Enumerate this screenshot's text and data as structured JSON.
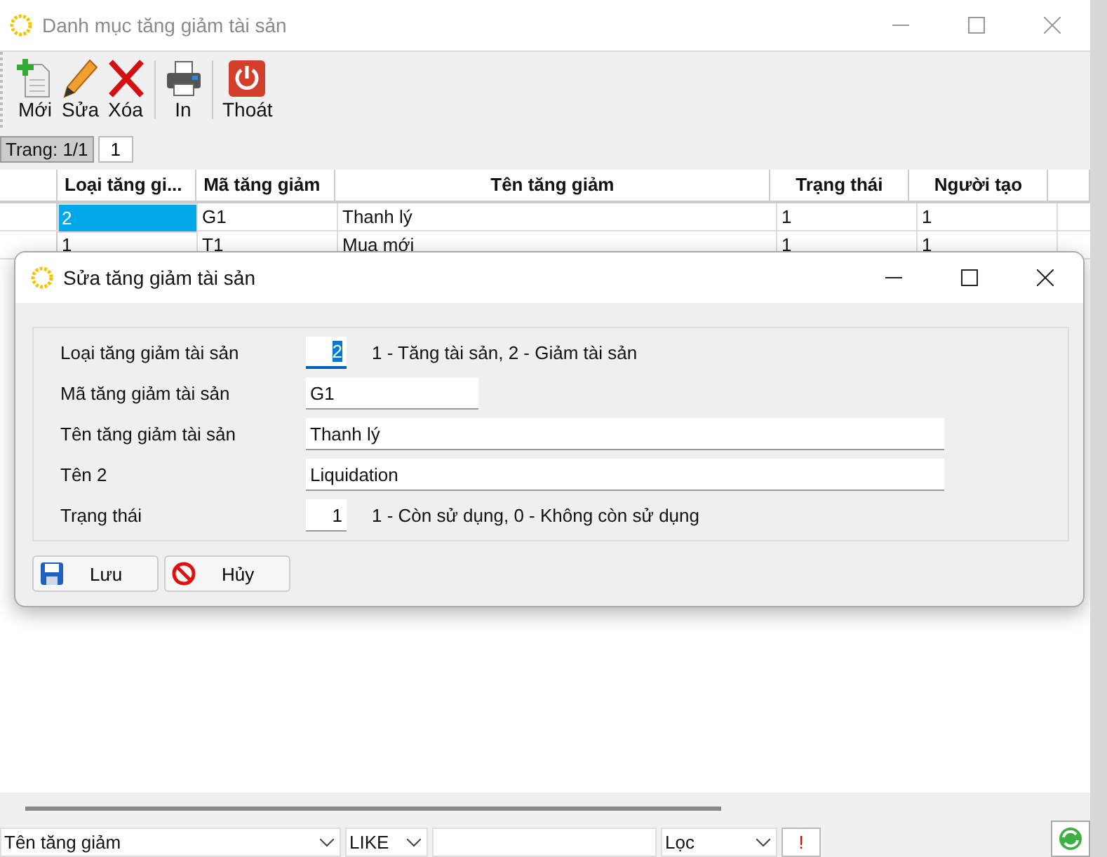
{
  "window": {
    "title": "Danh mục tăng giảm tài sản"
  },
  "toolbar": [
    {
      "kind": "new",
      "label": "Mới"
    },
    {
      "kind": "edit",
      "label": "Sửa"
    },
    {
      "kind": "delete",
      "label": "Xóa"
    },
    {
      "kind": "print",
      "label": "In"
    },
    {
      "kind": "exit",
      "label": "Thoát"
    }
  ],
  "pager": {
    "label": "Trang: 1/1",
    "page": "1"
  },
  "table": {
    "columns": [
      "Loại tăng gi...",
      "Mã tăng giảm",
      "Tên tăng giảm",
      "Trạng thái",
      "Người tạo"
    ],
    "rows": [
      {
        "selected": true,
        "cells": [
          "2",
          "G1",
          "Thanh lý",
          "1",
          "1"
        ]
      },
      {
        "selected": false,
        "cells": [
          "1",
          "T1",
          "Mua mới",
          "1",
          "1"
        ]
      }
    ]
  },
  "dialog": {
    "title": "Sửa tăng giảm tài sản",
    "fields": [
      {
        "kind": "short",
        "label": "Loại tăng giảm tài sản",
        "value": "2",
        "note": "1 - Tăng tài sản, 2 - Giảm tài sản",
        "selected": true
      },
      {
        "kind": "medium",
        "label": "Mã tăng giảm tài sản",
        "value": "G1"
      },
      {
        "kind": "long",
        "label": "Tên tăng giảm tài sản",
        "value": "Thanh lý"
      },
      {
        "kind": "long",
        "label": "Tên 2",
        "value": "Liquidation"
      },
      {
        "kind": "short",
        "label": "Trạng thái",
        "value": "1",
        "note": "1 - Còn sử dụng, 0 - Không còn sử dụng",
        "selected": false
      }
    ],
    "buttons": [
      {
        "kind": "save",
        "label": "Lưu"
      },
      {
        "kind": "cancel",
        "label": "Hủy"
      }
    ]
  },
  "filter": {
    "field": "Tên tăng giảm",
    "operator": "LIKE",
    "mode": "Lọc",
    "apply": "!"
  }
}
